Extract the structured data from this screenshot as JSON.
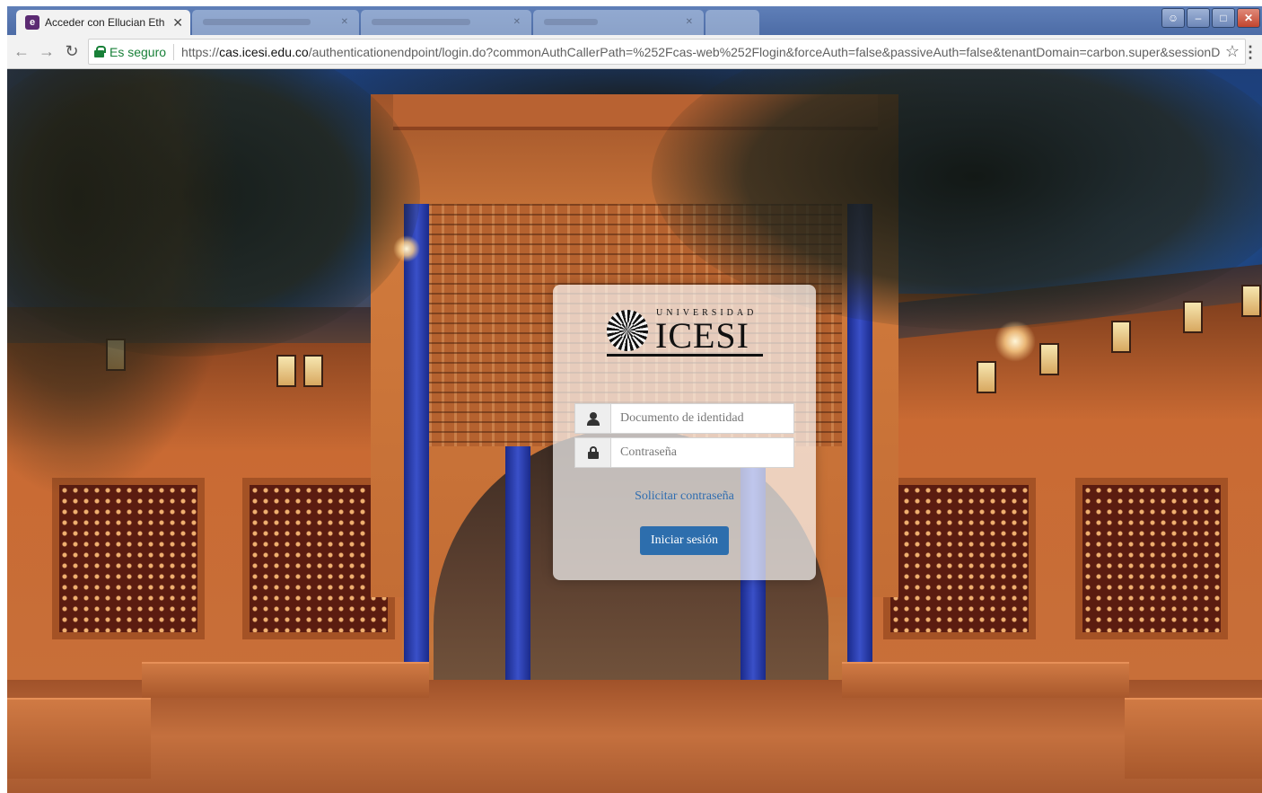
{
  "browser": {
    "active_tab": {
      "title": "Acceder con Ellucian Eth",
      "favicon_letter": "e"
    },
    "address_bar": {
      "security_label": "Es seguro",
      "url_scheme": "https://",
      "url_host": "cas.icesi.edu.co",
      "url_path": "/authenticationendpoint/login.do?commonAuthCallerPath=%252Fcas-web%252Flogin&forceAuth=false&passiveAuth=false&tenantDomain=carbon.super&sessionD..."
    }
  },
  "login": {
    "logo": {
      "top_text": "UNIVERSIDAD",
      "main_text": "ICESI"
    },
    "username": {
      "placeholder": "Documento de identidad",
      "value": ""
    },
    "password": {
      "placeholder": "Contraseña",
      "value": ""
    },
    "forgot_link": "Solicitar contraseña",
    "submit_label": "Iniciar sesión"
  },
  "colors": {
    "accent": "#2d6ead",
    "link": "#2f6db0",
    "secure": "#188038",
    "title_bar": "#5f7fb8"
  },
  "icons": {
    "back": "arrow-left-icon",
    "forward": "arrow-right-icon",
    "reload": "reload-icon",
    "lock": "lock-icon",
    "bookmark": "star-icon",
    "menu": "kebab-menu-icon",
    "user": "user-icon",
    "password": "padlock-icon"
  }
}
